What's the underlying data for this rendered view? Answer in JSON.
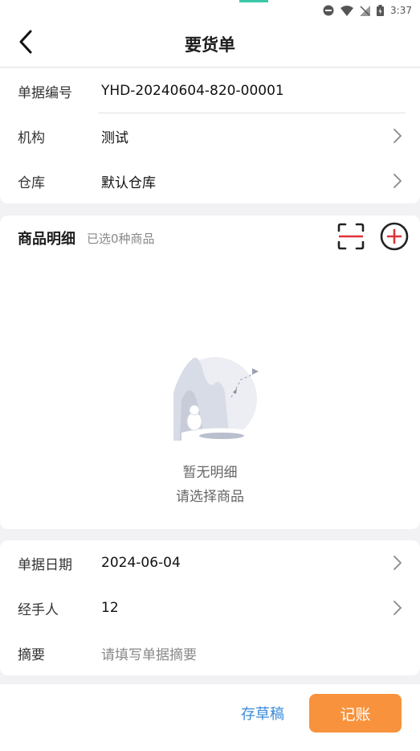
{
  "status_bar": {
    "time": "3:37"
  },
  "header": {
    "title": "要货单"
  },
  "form_top": {
    "doc_no": {
      "label": "单据编号",
      "value": "YHD-20240604-820-00001"
    },
    "org": {
      "label": "机构",
      "value": "测试"
    },
    "warehouse": {
      "label": "仓库",
      "value": "默认仓库"
    }
  },
  "goods": {
    "title": "商品明细",
    "count_text": "已选0种商品",
    "empty_line1": "暂无明细",
    "empty_line2": "请选择商品"
  },
  "form_bottom": {
    "date": {
      "label": "单据日期",
      "value": "2024-06-04"
    },
    "handler": {
      "label": "经手人",
      "value": "12"
    },
    "summary": {
      "label": "摘要",
      "placeholder": "请填写单据摘要"
    }
  },
  "footer": {
    "draft_label": "存草稿",
    "post_label": "记账"
  },
  "colors": {
    "accent_orange": "#f8923c",
    "link_blue": "#3a8bd8",
    "add_red": "#e0333a"
  },
  "icons": [
    "back-icon",
    "chevron-right-icon",
    "scan-icon",
    "add-circle-icon"
  ]
}
